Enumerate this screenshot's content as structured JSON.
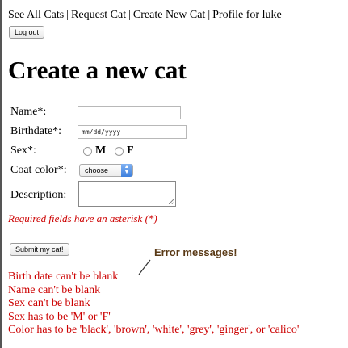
{
  "nav": {
    "links": [
      "See All Cats",
      "Request Cat",
      "Create New Cat",
      "Profile for luke"
    ],
    "separator": "|"
  },
  "logout_label": "Log out",
  "page_title": "Create a new cat",
  "form": {
    "name_label": "Name*:",
    "name_value": "",
    "birthdate_label": "Birthdate*:",
    "birthdate_value": "mm/dd/yyyy",
    "sex_label": "Sex*:",
    "sex_options": [
      "M",
      "F"
    ],
    "coat_label": "Coat color*:",
    "coat_selected": "choose",
    "description_label": "Description:",
    "description_value": "",
    "required_note": "Required fields have an asterisk (*)",
    "submit_label": "Submit my cat!"
  },
  "annotation": "Error messages!",
  "errors": [
    "Birth date can't be blank",
    "Name can't be blank",
    "Sex can't be blank",
    "Sex has to be 'M' or 'F'",
    "Color has to be 'black', 'brown', 'white', 'grey', 'ginger', or 'calico'"
  ],
  "colors": {
    "error": "#cc0000",
    "annotation": "#5a3a16",
    "select_accent": "#3d7fdd"
  }
}
